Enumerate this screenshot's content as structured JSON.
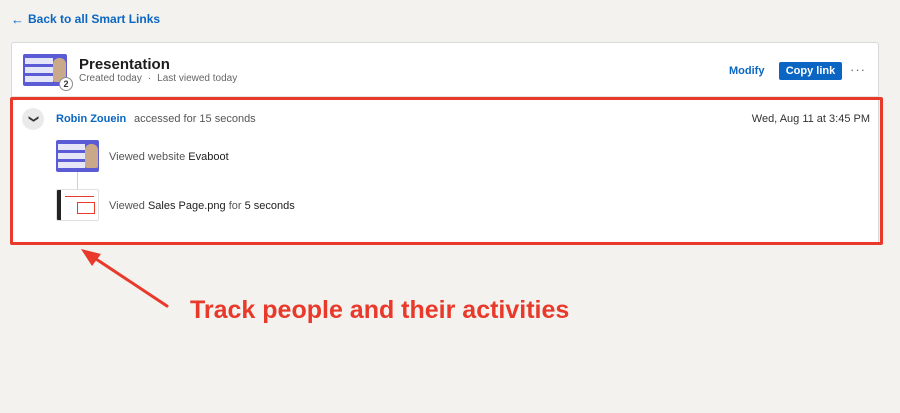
{
  "nav": {
    "back_label": "Back to all Smart Links"
  },
  "link": {
    "title": "Presentation",
    "created": "Created today",
    "separator": "·",
    "last_viewed": "Last viewed today",
    "view_count": "2",
    "modify_label": "Modify",
    "copy_label": "Copy link",
    "more_label": "···"
  },
  "activity": {
    "toggle_icon": "❯",
    "person": "Robin Zouein",
    "accessed_text": "accessed for 15 seconds",
    "timestamp": "Wed, Aug 11 at 3:45 PM",
    "items": [
      {
        "prefix": "Viewed website",
        "target": "Evaboot",
        "suffix": "",
        "duration": ""
      },
      {
        "prefix": "Viewed",
        "target": "Sales Page.png",
        "suffix": "for",
        "duration": "5 seconds"
      }
    ]
  },
  "annotation": {
    "caption": "Track people and their activities",
    "color": "#e8392a"
  },
  "colors": {
    "accent": "#0a66c2",
    "highlight": "#e8392a",
    "background": "#f3f2ef"
  }
}
